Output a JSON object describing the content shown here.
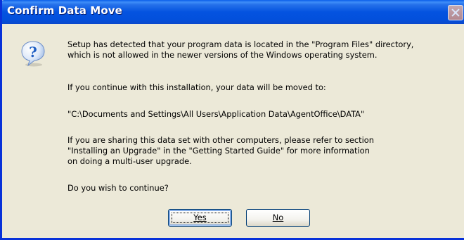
{
  "dialog": {
    "title": "Confirm Data Move",
    "icon": "question-icon",
    "message_lines": {
      "p1_l1": "Setup has detected that your program data is located in the \"Program Files\" directory,",
      "p1_l2": "which is not allowed in the newer versions of the Windows operating system.",
      "p2": "If you continue with this installation, your data will be moved to:",
      "p3": "\"C:\\Documents and Settings\\All Users\\Application Data\\AgentOffice\\DATA\"",
      "p4_l1": "If you are sharing this data set with other computers, please refer to section",
      "p4_l2": "\"Installing an Upgrade\" in the \"Getting Started Guide\" for more information",
      "p4_l3": "on doing a multi-user upgrade.",
      "p5": "Do you wish to continue?"
    },
    "buttons": {
      "yes": "Yes",
      "no": "No"
    }
  },
  "colors": {
    "titlebar": "#0453e0",
    "window_border": "#0831d9",
    "dialog_bg": "#ece9d8",
    "icon_blue": "#1f5fc4"
  }
}
